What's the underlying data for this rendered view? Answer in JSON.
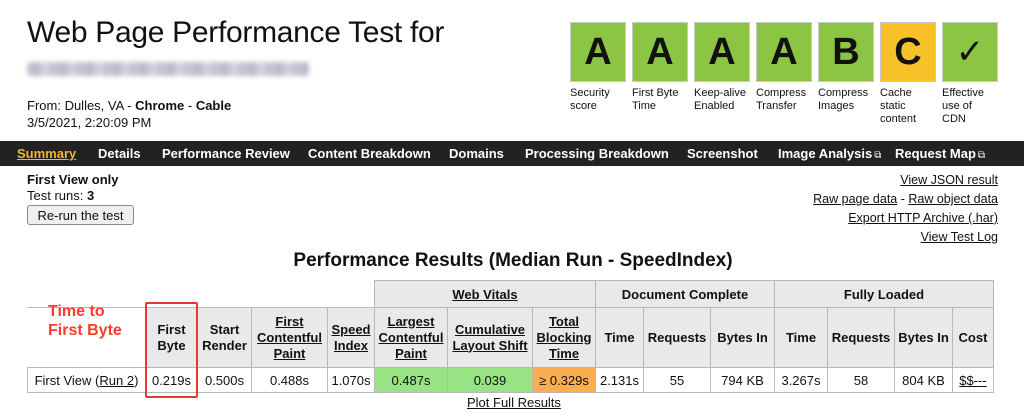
{
  "header": {
    "title": "Web Page Performance Test for",
    "from_prefix": "From: ",
    "from_location": "Dulles, VA - ",
    "browser": "Chrome",
    "sep": " - ",
    "connection": "Cable",
    "date": "3/5/2021, 2:20:09 PM"
  },
  "grades": [
    {
      "grade": "A",
      "label": "Security score",
      "color": "#8cc443"
    },
    {
      "grade": "A",
      "label": "First Byte Time",
      "color": "#8cc443"
    },
    {
      "grade": "A",
      "label": "Keep-alive Enabled",
      "color": "#8cc443"
    },
    {
      "grade": "A",
      "label": "Compress Transfer",
      "color": "#8cc443"
    },
    {
      "grade": "B",
      "label": "Compress Images",
      "color": "#8cc443"
    },
    {
      "grade": "C",
      "label": "Cache static content",
      "color": "#f8c029"
    },
    {
      "grade": "✓",
      "label": "Effective use of CDN",
      "color": "#8cc443"
    }
  ],
  "nav": [
    {
      "label": "Summary",
      "active": true
    },
    {
      "label": "Details"
    },
    {
      "label": "Performance Review"
    },
    {
      "label": "Content Breakdown"
    },
    {
      "label": "Domains"
    },
    {
      "label": "Processing Breakdown"
    },
    {
      "label": "Screenshot"
    },
    {
      "label": "Image Analysis",
      "external": true
    },
    {
      "label": "Request Map",
      "external": true
    }
  ],
  "info": {
    "first_view_only": "First View only",
    "test_runs_label": "Test runs: ",
    "test_runs_value": "3",
    "rerun_button": "Re-run the test"
  },
  "links": {
    "view_json": "View JSON result",
    "raw_page": "Raw page data",
    "dash": " - ",
    "raw_object": "Raw object data",
    "export_har": "Export HTTP Archive (.har)",
    "view_log": "View Test Log"
  },
  "results": {
    "title": "Performance Results (Median Run - SpeedIndex)",
    "groups": {
      "web_vitals": "Web Vitals",
      "document_complete": "Document Complete",
      "fully_loaded": "Fully Loaded"
    },
    "headers": {
      "first_byte": "First Byte",
      "start_render": "Start Render",
      "fcp": "First Contentful Paint",
      "speed_index": "Speed Index",
      "lcp": "Largest Contentful Paint",
      "cls": "Cumulative Layout Shift",
      "tbt": "Total Blocking Time",
      "dc_time": "Time",
      "dc_requests": "Requests",
      "dc_bytes": "Bytes In",
      "fl_time": "Time",
      "fl_requests": "Requests",
      "fl_bytes": "Bytes In",
      "cost": "Cost"
    },
    "row": {
      "label": "First View (",
      "run_link": "Run 2",
      "label_end": ")",
      "first_byte": "0.219s",
      "start_render": "0.500s",
      "fcp": "0.488s",
      "speed_index": "1.070s",
      "lcp": "0.487s",
      "cls": "0.039",
      "tbt": "≥ 0.329s",
      "dc_time": "2.131s",
      "dc_requests": "55",
      "dc_bytes": "794 KB",
      "fl_time": "3.267s",
      "fl_requests": "58",
      "fl_bytes": "804 KB",
      "cost": "$$---"
    },
    "plot_link": "Plot Full Results"
  },
  "annotation": {
    "line1": "Time to",
    "line2": "First Byte",
    "color": "#ff3b2a"
  },
  "icons": {
    "external_link": "external-link-icon"
  }
}
